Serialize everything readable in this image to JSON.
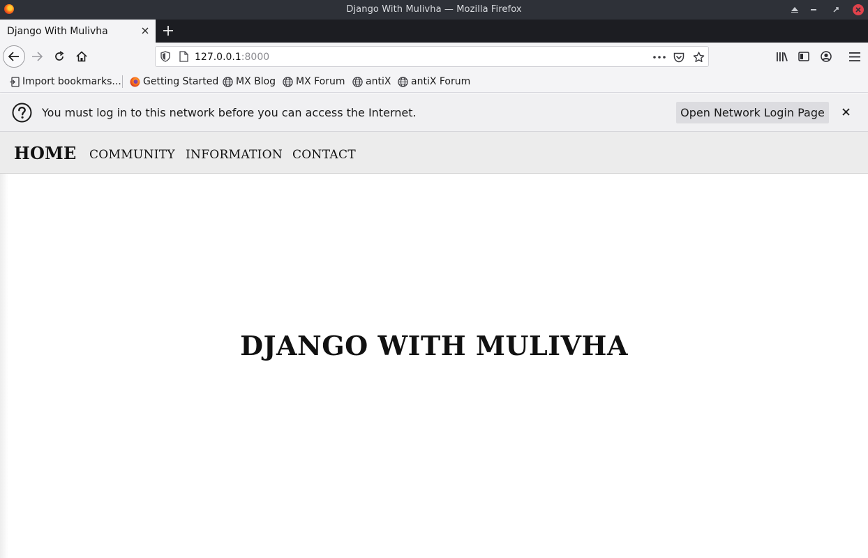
{
  "window": {
    "title": "Django With Mulivha — Mozilla Firefox"
  },
  "tabs": [
    {
      "label": "Django With Mulivha",
      "active": true
    }
  ],
  "urlbar": {
    "host": "127.0.0.1",
    "port": ":8000"
  },
  "bookmarks": [
    {
      "label": "Import bookmarks...",
      "icon": "import-icon"
    },
    {
      "label": "Getting Started",
      "icon": "firefox-icon"
    },
    {
      "label": "MX Blog",
      "icon": "globe-icon"
    },
    {
      "label": "MX Forum",
      "icon": "globe-icon"
    },
    {
      "label": "antiX",
      "icon": "globe-icon"
    },
    {
      "label": "antiX Forum",
      "icon": "globe-icon"
    }
  ],
  "notification": {
    "message": "You must log in to this network before you can access the Internet.",
    "button_label": "Open Network Login Page"
  },
  "site": {
    "brand": "HOME",
    "nav": [
      "COMMUNITY",
      "INFORMATION",
      "CONTACT"
    ],
    "heading": "DJANGO WITH MULIVHA"
  },
  "colors": {
    "titlebar_bg": "#2e3138",
    "tabstrip_bg": "#1c1d22",
    "toolbar_bg": "#f4f4f6",
    "site_nav_bg": "#ececec",
    "close_button": "#e0424b"
  }
}
